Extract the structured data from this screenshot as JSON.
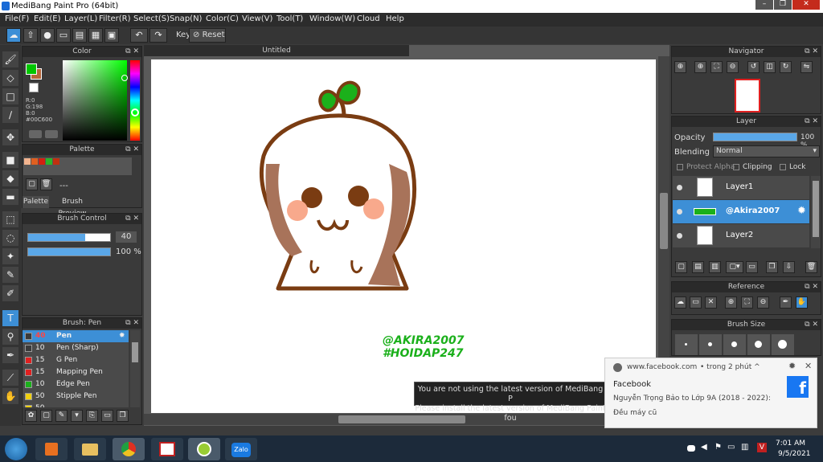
{
  "window": {
    "title": "MediBang Paint Pro (64bit)"
  },
  "menu": [
    "File(F)",
    "Edit(E)",
    "Layer(L)",
    "Filter(R)",
    "Select(S)",
    "Snap(N)",
    "Color(C)",
    "View(V)",
    "Tool(T)",
    "Window(W)",
    "Cloud",
    "Help"
  ],
  "toolbar": {
    "key_label": "Key",
    "reset_label": "Reset"
  },
  "color_panel": {
    "title": "Color",
    "r": "R:0",
    "g": "G:198",
    "b": "B:0",
    "hex": "#00C600",
    "foreground": "#00c600",
    "background": "#b5653a"
  },
  "palette_panel": {
    "title": "Palette",
    "colors": [
      "#f2b48f",
      "#e06020",
      "#d42010",
      "#2bb52a",
      "#c03010"
    ],
    "dashes": "---",
    "tab_palette": "Palette",
    "tab_brush_preview": "Brush Preview"
  },
  "brush_control": {
    "title": "Brush Control",
    "size": "40",
    "opacity": "100 %",
    "size_fraction": 0.7,
    "opacity_fraction": 1.0
  },
  "brush_panel": {
    "title": "Brush: Pen",
    "brushes": [
      {
        "size": "40",
        "name": "Pen",
        "color": "#3a3a3a",
        "selected": true
      },
      {
        "size": "10",
        "name": "Pen (Sharp)",
        "color": "#3a3a3a",
        "selected": false
      },
      {
        "size": "15",
        "name": "G Pen",
        "color": "#e02020",
        "selected": false
      },
      {
        "size": "15",
        "name": "Mapping Pen",
        "color": "#e02020",
        "selected": false
      },
      {
        "size": "10",
        "name": "Edge Pen",
        "color": "#1bb01b",
        "selected": false
      },
      {
        "size": "50",
        "name": "Stipple Pen",
        "color": "#f0d010",
        "selected": false
      },
      {
        "size": "50",
        "name": "",
        "color": "#f0d010",
        "selected": false
      }
    ]
  },
  "canvas": {
    "tab_title": "Untitled",
    "watermark_line1": "@AKIRA2007",
    "watermark_line2": "#HOIDAP247"
  },
  "tooltip": {
    "line1": "You are not using the latest version of MediBang P",
    "line2": "Please install the latest version of MediBang Paint fou"
  },
  "navigator": {
    "title": "Navigator"
  },
  "layer_panel": {
    "title": "Layer",
    "opacity_label": "Opacity",
    "opacity_value": "100 %",
    "blending_label": "Blending",
    "blending_value": "Normal",
    "protect_alpha": "Protect Alpha",
    "clipping": "Clipping",
    "lock": "Lock",
    "layers": [
      {
        "name": "Layer1",
        "selected": false
      },
      {
        "name": "@Akira2007",
        "selected": true
      },
      {
        "name": "Layer2",
        "selected": false
      }
    ]
  },
  "reference_panel": {
    "title": "Reference"
  },
  "brush_size_panel": {
    "title": "Brush Size"
  },
  "notification": {
    "source": "www.facebook.com",
    "time": "• trong 2 phút ^",
    "app": "Facebook",
    "body": "Nguyễn Trọng Bảo to Lớp 9A (2018 - 2022):",
    "message": "Đều máy cũ"
  },
  "taskbar": {
    "time": "7:01 AM",
    "date": "9/5/2021",
    "zalo": "Zalo"
  }
}
